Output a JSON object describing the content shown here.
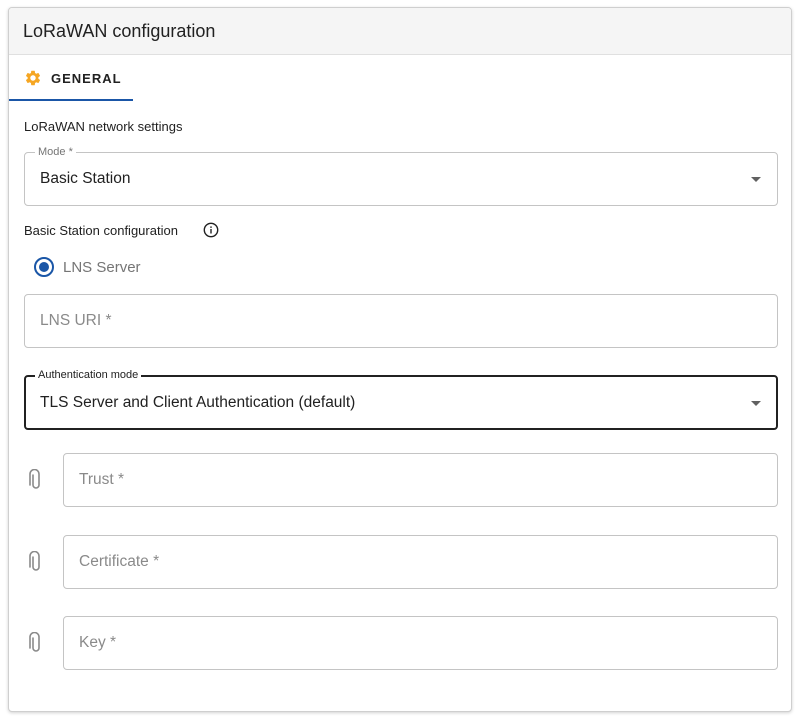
{
  "card": {
    "title": "LoRaWAN configuration"
  },
  "tabs": [
    {
      "label": "GENERAL",
      "icon": "gear-icon",
      "active": true
    }
  ],
  "network_settings": {
    "label": "LoRaWAN network settings"
  },
  "mode": {
    "legend": "Mode *",
    "value": "Basic Station"
  },
  "basic_station": {
    "label": "Basic Station configuration",
    "info_icon": "info-icon",
    "radio": {
      "label": "LNS Server",
      "checked": true
    },
    "lns_uri": {
      "placeholder": "LNS URI *",
      "value": ""
    }
  },
  "auth": {
    "legend": "Authentication mode",
    "value": "TLS Server and Client Authentication (default)"
  },
  "files": [
    {
      "placeholder": "Trust *",
      "icon": "paperclip-icon"
    },
    {
      "placeholder": "Certificate *",
      "icon": "paperclip-icon"
    },
    {
      "placeholder": "Key *",
      "icon": "paperclip-icon"
    }
  ],
  "colors": {
    "accent": "#1a56a7",
    "tab_icon": "#f5a623",
    "border": "#c4c4c4"
  }
}
